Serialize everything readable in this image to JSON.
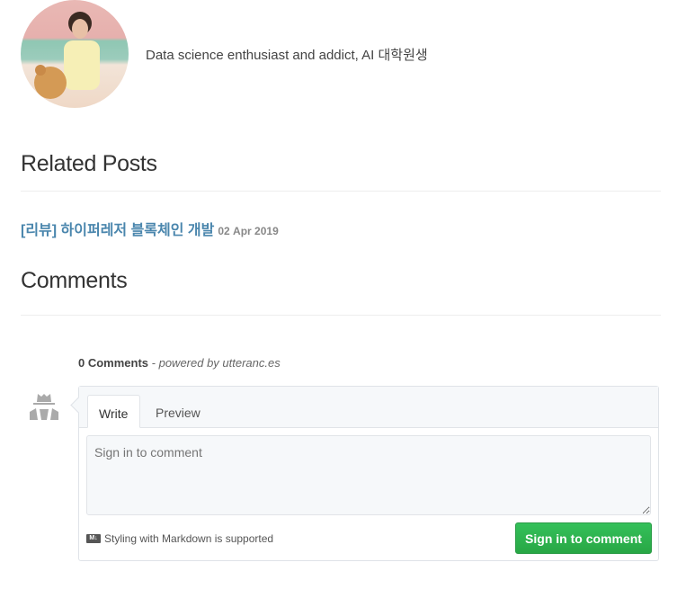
{
  "author": {
    "bio": "Data science enthusiast and addict, AI 대학원생"
  },
  "related": {
    "heading": "Related Posts",
    "posts": [
      {
        "title": "[리뷰] 하이퍼레저 블록체인 개발",
        "date": "02 Apr 2019"
      }
    ]
  },
  "comments": {
    "heading": "Comments",
    "count_label": "0 Comments",
    "powered_by": "- powered by utteranc.es",
    "tabs": [
      "Write",
      "Preview"
    ],
    "placeholder": "Sign in to comment",
    "markdown_icon": "M↓",
    "markdown_note": "Styling with Markdown is supported",
    "signin_label": "Sign in to comment",
    "accent": "#28a745",
    "link_color": "#4a86ad"
  }
}
